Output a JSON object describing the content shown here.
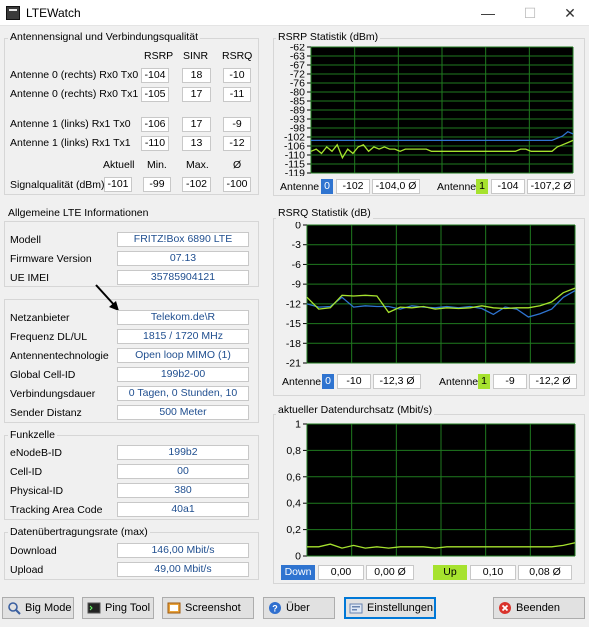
{
  "window": {
    "title": "LTEWatch",
    "minimize": "—",
    "maximize": "☐",
    "close": "✕"
  },
  "antenna": {
    "title": "Antennensignal und Verbindungsqualität",
    "headers": [
      "RSRP",
      "SINR",
      "RSRQ"
    ],
    "rows": [
      {
        "label": "Antenne 0 (rechts) Rx0 Tx0",
        "rsrp": "-104",
        "sinr": "18",
        "rsrq": "-10"
      },
      {
        "label": "Antenne 0 (rechts) Rx0 Tx1",
        "rsrp": "-105",
        "sinr": "17",
        "rsrq": "-11"
      },
      {
        "label": "Antenne 1 (links) Rx1 Tx0",
        "rsrp": "-106",
        "sinr": "17",
        "rsrq": "-9"
      },
      {
        "label": "Antenne 1 (links) Rx1 Tx1",
        "rsrp": "-110",
        "sinr": "13",
        "rsrq": "-12"
      }
    ],
    "quality_headers": [
      "Aktuell",
      "Min.",
      "Max.",
      "Ø"
    ],
    "quality_label": "Signalqualität (dBm)",
    "quality_values": [
      "-101",
      "-99",
      "-102",
      "-100"
    ]
  },
  "lte": {
    "title": "Allgemeine LTE Informationen",
    "fields": [
      {
        "label": "Modell",
        "value": "FRITZ!Box 6890 LTE"
      },
      {
        "label": "Firmware Version",
        "value": "07.13"
      },
      {
        "label": "UE IMEI",
        "value": "35785904121"
      }
    ],
    "net": [
      {
        "label": "Netzanbieter",
        "value": "Telekom.de\\R"
      },
      {
        "label": "Frequenz DL/UL",
        "value": "1815 / 1720 MHz"
      },
      {
        "label": "Antennentechnologie",
        "value": "Open loop MIMO (1)"
      },
      {
        "label": "Global Cell-ID",
        "value": "199b2-00"
      },
      {
        "label": "Verbindungsdauer",
        "value": "0 Tagen, 0 Stunden, 10"
      },
      {
        "label": "Sender Distanz",
        "value": "500 Meter"
      }
    ]
  },
  "funkzelle": {
    "title": "Funkzelle",
    "fields": [
      {
        "label": "eNodeB-ID",
        "value": "199b2"
      },
      {
        "label": "Cell-ID",
        "value": "00"
      },
      {
        "label": "Physical-ID",
        "value": "380"
      },
      {
        "label": "Tracking Area Code",
        "value": "40a1"
      }
    ]
  },
  "rate": {
    "title": "Datenübertragungsrate (max)",
    "fields": [
      {
        "label": "Download",
        "value": "146,00 Mbit/s"
      },
      {
        "label": "Upload",
        "value": "49,00 Mbit/s"
      }
    ]
  },
  "rsrp_panel": {
    "title": "RSRP Statistik (dBm)",
    "ant_label": "Antenne",
    "a0": "0",
    "a0_cur": "-102",
    "a0_avg": "-104,0 Ø",
    "a1": "1",
    "a1_cur": "-104",
    "a1_avg": "-107,2 Ø"
  },
  "rsrq_panel": {
    "title": "RSRQ Statistik (dB)",
    "ant_label": "Antenne",
    "a0": "0",
    "a0_cur": "-10",
    "a0_avg": "-12,3 Ø",
    "a1": "1",
    "a1_cur": "-9",
    "a1_avg": "-12,2 Ø"
  },
  "thr_panel": {
    "title": "aktueller Datendurchsatz (Mbit/s)",
    "down": "Down",
    "down_cur": "0,00",
    "down_avg": "0,00 Ø",
    "up": "Up",
    "up_cur": "0,10",
    "up_avg": "0,08 Ø"
  },
  "buttons": {
    "bigmode": "Big Mode",
    "ping": "Ping Tool",
    "screenshot": "Screenshot",
    "ueber": "Über",
    "einstellungen": "Einstellungen",
    "beenden": "Beenden"
  },
  "colors": {
    "ant0": "#2f74d0",
    "ant1": "#a6e22e",
    "grid": "#1f7a1f",
    "plot_bg": "#000000"
  },
  "chart_data": [
    {
      "type": "line",
      "title": "RSRP Statistik (dBm)",
      "ylim": [
        -120,
        -62
      ],
      "yticks": [
        "-62",
        "-63",
        "-67",
        "-72",
        "-76",
        "-80",
        "-85",
        "-89",
        "-93",
        "-98",
        "-102",
        "-106",
        "-110",
        "-115",
        "-119"
      ],
      "series": [
        {
          "values": [
            -105,
            -105,
            -105,
            -105,
            -105,
            -105,
            -105,
            -105,
            -105,
            -105,
            -105,
            -105,
            -105,
            -105,
            -105,
            -105,
            -105,
            -105,
            -105,
            -105,
            -105,
            -105,
            -105,
            -105,
            -105,
            -105,
            -105,
            -105,
            -105,
            -105,
            -105,
            -105,
            -105,
            -105,
            -105,
            -105,
            -105,
            -105,
            -105,
            -105,
            -105,
            -105,
            -105,
            -105,
            -105,
            -105,
            -105,
            -104,
            -103,
            -101,
            -102
          ]
        },
        {
          "values": [
            -110,
            -109,
            -111,
            -108,
            -110,
            -107,
            -113,
            -109,
            -111,
            -108,
            -107,
            -110,
            -108,
            -109,
            -108,
            -109,
            -109,
            -110,
            -109,
            -109,
            -109,
            -109,
            -109,
            -110,
            -110,
            -110,
            -110,
            -110,
            -110,
            -110,
            -110,
            -110,
            -110,
            -110,
            -110,
            -110,
            -110,
            -110,
            -110,
            -110,
            -109,
            -109,
            -110,
            -110,
            -110,
            -110,
            -110,
            -108,
            -107,
            -106,
            -105
          ]
        }
      ]
    },
    {
      "type": "line",
      "title": "RSRQ Statistik (dB)",
      "ylim": [
        -21,
        0
      ],
      "yticks": [
        "0",
        "-3",
        "-6",
        "-9",
        "-12",
        "-15",
        "-18",
        "-21"
      ],
      "series": [
        {
          "values": [
            -12,
            -12.5,
            -12.4,
            -11,
            -12.5,
            -12.3,
            -12.4,
            -12.4,
            -12.8,
            -12.3,
            -12.5,
            -12.6,
            -12.4,
            -12.6,
            -12.4,
            -12.7,
            -13.6,
            -12.5,
            -12.8,
            -14,
            -13.5,
            -12.8,
            -11,
            -10
          ]
        },
        {
          "values": [
            -11,
            -12.8,
            -12.6,
            -10.7,
            -10.8,
            -10.7,
            -10.8,
            -13.3,
            -12.5,
            -12.6,
            -12.4,
            -12.8,
            -12.6,
            -12.7,
            -12.6,
            -12.3,
            -12.6,
            -12.7,
            -12.6,
            -12.6,
            -12.3,
            -11.7,
            -10.3,
            -9.6
          ]
        }
      ]
    },
    {
      "type": "line",
      "title": "aktueller Datendurchsatz (Mbit/s)",
      "ylim": [
        0,
        1
      ],
      "yticks": [
        "1",
        "0,8",
        "0,6",
        "0,4",
        "0,2",
        "0"
      ],
      "series": [
        {
          "values": [
            0.07,
            0.07,
            0.09,
            0.06,
            0.08,
            0.06,
            0.07,
            0.06,
            0.07,
            0.07,
            0.07,
            0.06,
            0.07,
            0.07,
            0.07,
            0.07,
            0.07,
            0.07,
            0.07,
            0.07,
            0.07,
            0.07,
            0.08,
            0.1
          ]
        }
      ]
    }
  ]
}
